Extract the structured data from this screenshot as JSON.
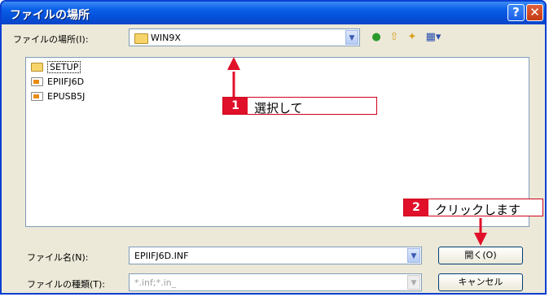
{
  "window": {
    "title": "ファイルの場所",
    "help_label": "?",
    "close_label": "✕"
  },
  "look_in": {
    "label": "ファイルの場所(I):",
    "value": "WIN9X"
  },
  "toolbar": {
    "icons": [
      "back-icon",
      "up-folder-icon",
      "new-folder-icon",
      "view-menu-icon"
    ]
  },
  "files": [
    {
      "name": "SETUP",
      "icon": "folder-icon",
      "selected": true
    },
    {
      "name": "EPIIFJ6D",
      "icon": "setup-info-icon",
      "selected": false
    },
    {
      "name": "EPUSB5J",
      "icon": "setup-info-icon",
      "selected": false
    }
  ],
  "filename": {
    "label": "ファイル名(N):",
    "value": "EPIIFJ6D.INF"
  },
  "filetype": {
    "label": "ファイルの種類(T):",
    "value": "*.inf;*.in_"
  },
  "buttons": {
    "open": "開く(O)",
    "cancel": "キャンセル"
  },
  "annotations": [
    {
      "number": "1",
      "text": "選択して"
    },
    {
      "number": "2",
      "text": "クリックします"
    }
  ],
  "colors": {
    "title_bar": "#0a5fe8",
    "callout_red": "#e0102a"
  }
}
